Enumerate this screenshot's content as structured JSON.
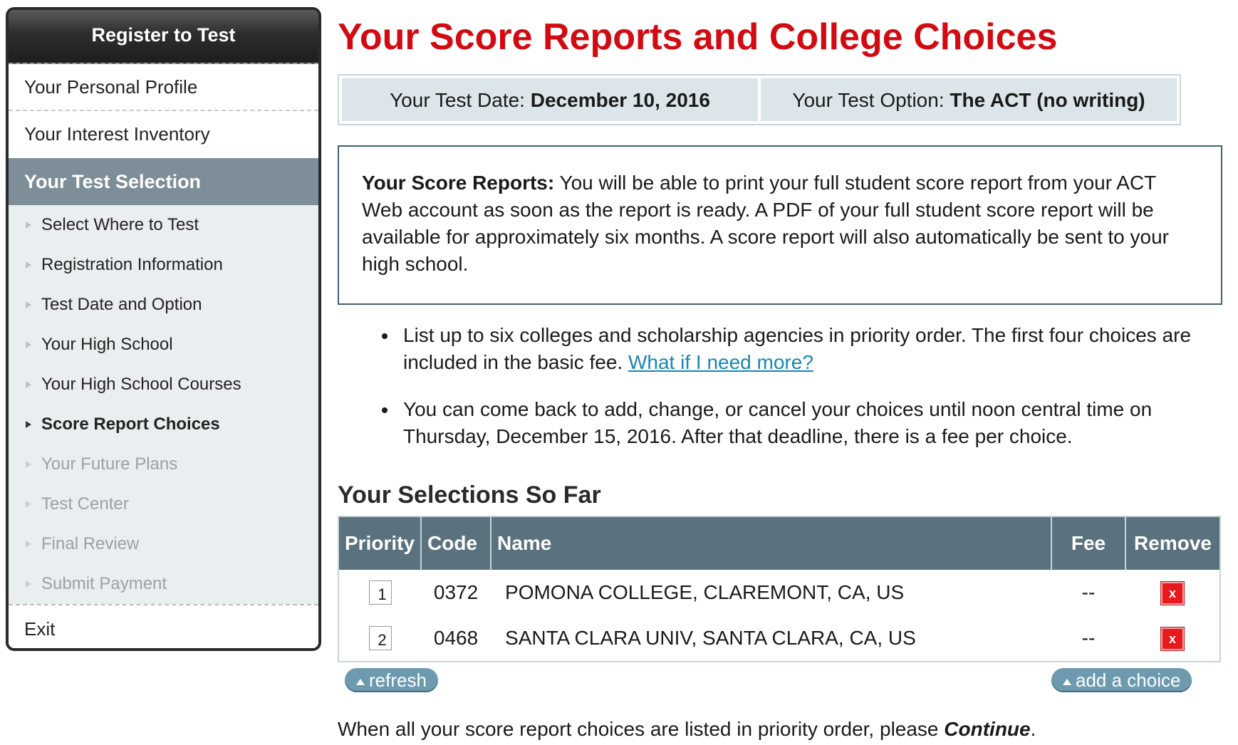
{
  "sidebar": {
    "header": "Register to Test",
    "top_items": [
      {
        "label": "Your Personal Profile"
      },
      {
        "label": "Your Interest Inventory"
      }
    ],
    "current_section": "Your Test Selection",
    "sub_items": [
      {
        "label": "Select Where to Test",
        "state": "normal"
      },
      {
        "label": "Registration Information",
        "state": "normal"
      },
      {
        "label": "Test Date and Option",
        "state": "normal"
      },
      {
        "label": "Your High School",
        "state": "normal"
      },
      {
        "label": "Your High School Courses",
        "state": "normal"
      },
      {
        "label": "Score Report Choices",
        "state": "active"
      },
      {
        "label": "Your Future Plans",
        "state": "disabled"
      },
      {
        "label": "Test Center",
        "state": "disabled"
      },
      {
        "label": "Final Review",
        "state": "disabled"
      },
      {
        "label": "Submit Payment",
        "state": "disabled"
      }
    ],
    "exit_label": "Exit"
  },
  "page": {
    "title": "Your Score Reports and College Choices",
    "test_date_label": "Your Test Date: ",
    "test_date_value": "December 10, 2016",
    "test_option_label": "Your Test Option: ",
    "test_option_value": "The ACT (no writing)"
  },
  "info_box": {
    "heading": "Your Score Reports:",
    "text": " You will be able to print your full student score report from your ACT Web account as soon as the report is ready. A PDF of your full student score report will be available for approximately six months. A score report will also automatically be sent to your high school."
  },
  "bullets": {
    "first_text": "List up to six colleges and scholarship agencies in priority order. The first four choices are included in the basic fee. ",
    "first_link": "What if I need more?",
    "second_text": "You can come back to add, change, or cancel your choices until noon central time on Thursday, December 15, 2016. After that deadline, there is a fee per choice."
  },
  "selections": {
    "heading": "Your Selections So Far",
    "columns": {
      "priority": "Priority",
      "code": "Code",
      "name": "Name",
      "fee": "Fee",
      "remove": "Remove"
    },
    "rows": [
      {
        "priority": "1",
        "code": "0372",
        "name": "POMONA COLLEGE, CLAREMONT, CA, US",
        "fee": "--",
        "remove_symbol": "x"
      },
      {
        "priority": "2",
        "code": "0468",
        "name": "SANTA CLARA UNIV, SANTA CLARA, CA, US",
        "fee": "--",
        "remove_symbol": "x"
      }
    ],
    "refresh_label": "refresh",
    "add_label": "add a choice"
  },
  "footer": {
    "text": "When all your score report choices are listed in priority order, please ",
    "emphasis": "Continue",
    "end": "."
  },
  "colors": {
    "title_red": "#d20a11",
    "table_header": "#59727e",
    "sidebar_current": "#7d8e98",
    "link_blue": "#1a86b6",
    "pill_button": "#6d9aae"
  }
}
